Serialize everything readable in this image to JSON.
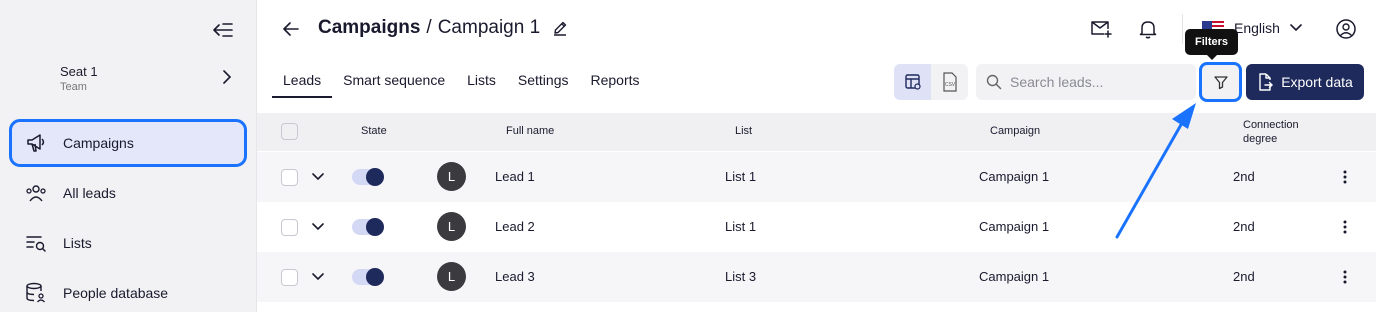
{
  "sidebar": {
    "seat_name": "Seat 1",
    "seat_sub": "Team",
    "items": [
      {
        "label": "Campaigns",
        "icon": "megaphone-icon",
        "active": true
      },
      {
        "label": "All leads",
        "icon": "users-icon",
        "active": false
      },
      {
        "label": "Lists",
        "icon": "list-search-icon",
        "active": false
      },
      {
        "label": "People database",
        "icon": "database-user-icon",
        "active": false
      }
    ]
  },
  "header": {
    "title_main": "Campaigns",
    "title_sep": "/",
    "title_sub": "Campaign 1",
    "language": "English"
  },
  "tabs": [
    {
      "label": "Leads",
      "active": true
    },
    {
      "label": "Smart sequence",
      "active": false
    },
    {
      "label": "Lists",
      "active": false
    },
    {
      "label": "Settings",
      "active": false
    },
    {
      "label": "Reports",
      "active": false
    }
  ],
  "toolbar": {
    "search_placeholder": "Search leads...",
    "filter_tooltip": "Filters",
    "export_label": "Export data",
    "csv_label": "CSV"
  },
  "table": {
    "headers": {
      "state": "State",
      "full_name": "Full name",
      "list": "List",
      "campaign": "Campaign",
      "connection_1": "Connection",
      "connection_2": "degree"
    },
    "rows": [
      {
        "avatar": "L",
        "name": "Lead 1",
        "list": "List 1",
        "campaign": "Campaign 1",
        "degree": "2nd",
        "state_on": true
      },
      {
        "avatar": "L",
        "name": "Lead 2",
        "list": "List 1",
        "campaign": "Campaign 1",
        "degree": "2nd",
        "state_on": true
      },
      {
        "avatar": "L",
        "name": "Lead 3",
        "list": "List 3",
        "campaign": "Campaign 1",
        "degree": "2nd",
        "state_on": true
      }
    ]
  },
  "colors": {
    "accent": "#1f2a5c",
    "highlight": "#1a73ff",
    "sidebar_bg": "#f2f2f4"
  }
}
